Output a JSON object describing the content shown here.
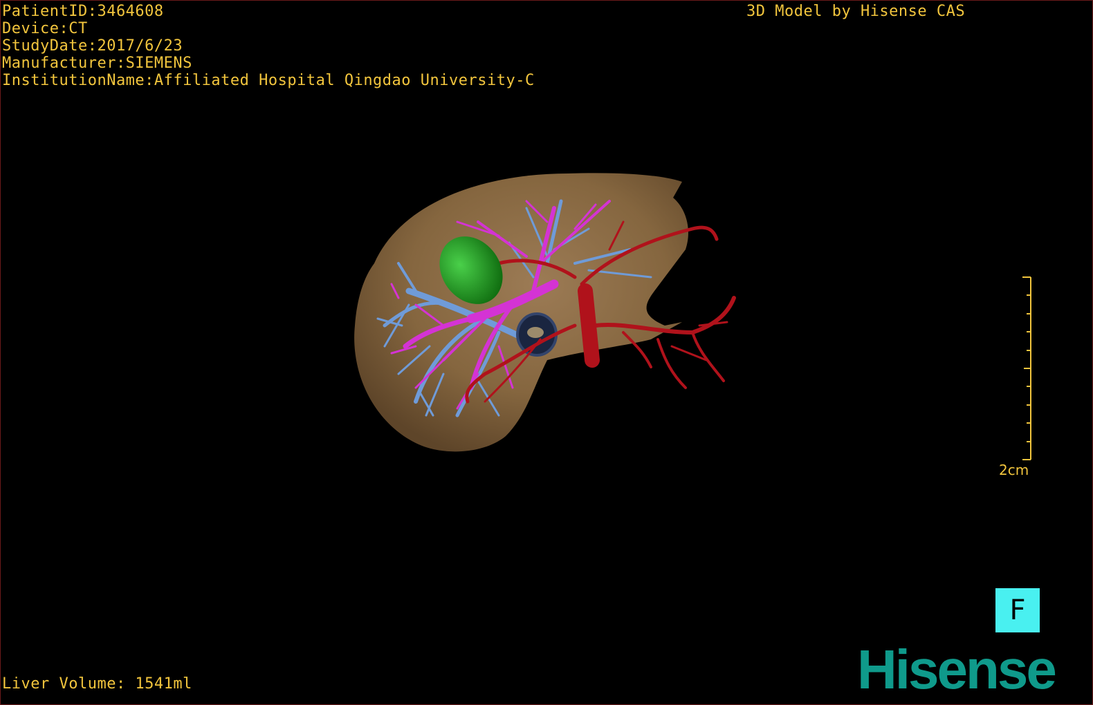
{
  "header": {
    "patient_id": "PatientID:3464608",
    "device": "Device:CT",
    "study_date": "StudyDate:2017/6/23",
    "manufacturer": "Manufacturer:SIEMENS",
    "institution": "InstitutionName:Affiliated Hospital Qingdao University-C"
  },
  "credit": "3D Model by Hisense CAS",
  "footer": {
    "liver_volume": "Liver Volume: 1541ml"
  },
  "scale": {
    "label": "2cm"
  },
  "orientation": {
    "label": "F"
  },
  "brand": {
    "name": "Hisense"
  },
  "colors": {
    "text": "#f2c53d",
    "background": "#000000",
    "liver": "#8a6a48",
    "hepatic_vein": "#6f9bd8",
    "portal_vein": "#d433d4",
    "artery": "#b0121b",
    "tumor": "#1ea01e",
    "orientation_cube": "#49f0f0",
    "brand": "#0f9a8b"
  }
}
